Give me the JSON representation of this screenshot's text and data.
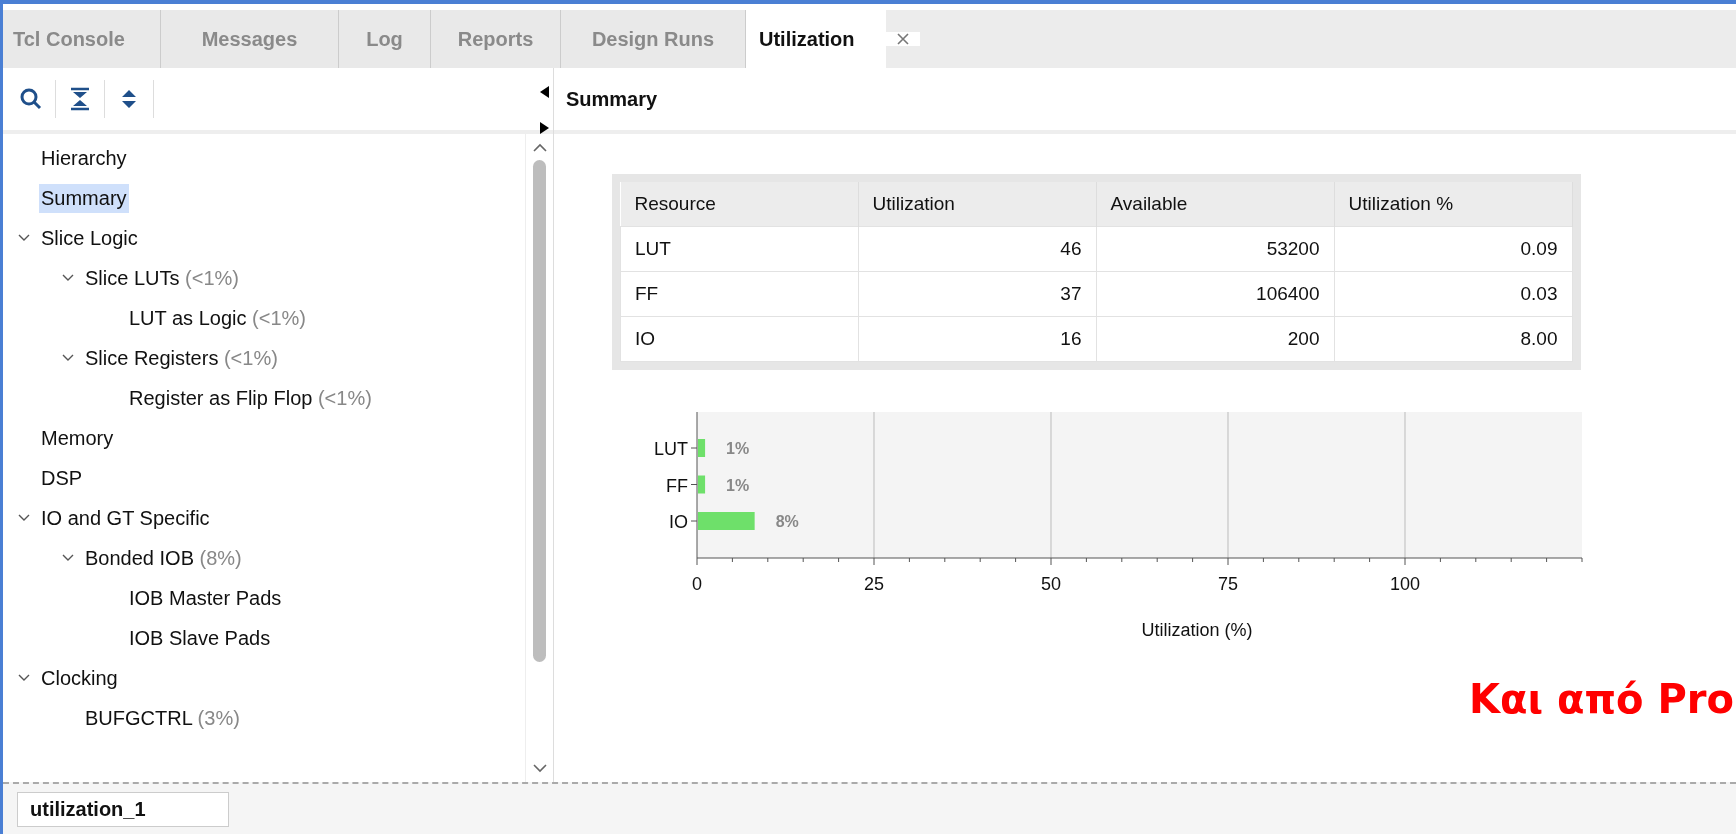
{
  "tabs": [
    {
      "label": "Tcl Console",
      "selected": false,
      "closable": false
    },
    {
      "label": "Messages",
      "selected": false,
      "closable": false
    },
    {
      "label": "Log",
      "selected": false,
      "closable": false
    },
    {
      "label": "Reports",
      "selected": false,
      "closable": false
    },
    {
      "label": "Design Runs",
      "selected": false,
      "closable": false
    },
    {
      "label": "Utilization",
      "selected": true,
      "closable": true
    }
  ],
  "tree": [
    {
      "label": "Hierarchy",
      "selected": false
    },
    {
      "label": "Summary",
      "selected": true
    },
    {
      "label": "Slice Logic",
      "selected": false,
      "expanded": true,
      "children": [
        {
          "label": "Slice LUTs",
          "note": "(<1%)",
          "selected": false,
          "expanded": true,
          "children": [
            {
              "label": "LUT as Logic",
              "note": "(<1%)",
              "selected": false
            }
          ]
        },
        {
          "label": "Slice Registers",
          "note": "(<1%)",
          "selected": false,
          "expanded": true,
          "children": [
            {
              "label": "Register as Flip Flop",
              "note": "(<1%)",
              "selected": false
            }
          ]
        }
      ]
    },
    {
      "label": "Memory",
      "selected": false
    },
    {
      "label": "DSP",
      "selected": false
    },
    {
      "label": "IO and GT Specific",
      "selected": false,
      "expanded": true,
      "children": [
        {
          "label": "Bonded IOB",
          "note": "(8%)",
          "selected": false,
          "expanded": true,
          "children": [
            {
              "label": "IOB Master Pads",
              "selected": false
            },
            {
              "label": "IOB Slave Pads",
              "selected": false
            }
          ]
        }
      ]
    },
    {
      "label": "Clocking",
      "selected": false,
      "expanded": true,
      "children": [
        {
          "label": "BUFGCTRL",
          "note": "(3%)",
          "selected": false
        }
      ]
    }
  ],
  "panel": {
    "title": "Summary"
  },
  "table": {
    "columns": [
      "Resource",
      "Utilization",
      "Available",
      "Utilization %"
    ],
    "rows": [
      [
        "LUT",
        "46",
        "53200",
        "0.09"
      ],
      [
        "FF",
        "37",
        "106400",
        "0.03"
      ],
      [
        "IO",
        "16",
        "200",
        "8.00"
      ]
    ]
  },
  "chart_data": {
    "type": "bar",
    "orientation": "horizontal",
    "grid": true,
    "xlabel": "Utilization (%)",
    "categories": [
      "LUT",
      "FF",
      "IO"
    ],
    "values": [
      1,
      1,
      8
    ],
    "value_labels": [
      "1%",
      "1%",
      "8%"
    ],
    "xlim": [
      0,
      125
    ],
    "xticks": [
      0,
      25,
      50,
      75,
      100
    ]
  },
  "annotation": "Και από Pro",
  "footer": {
    "run_name": "utilization_1"
  }
}
